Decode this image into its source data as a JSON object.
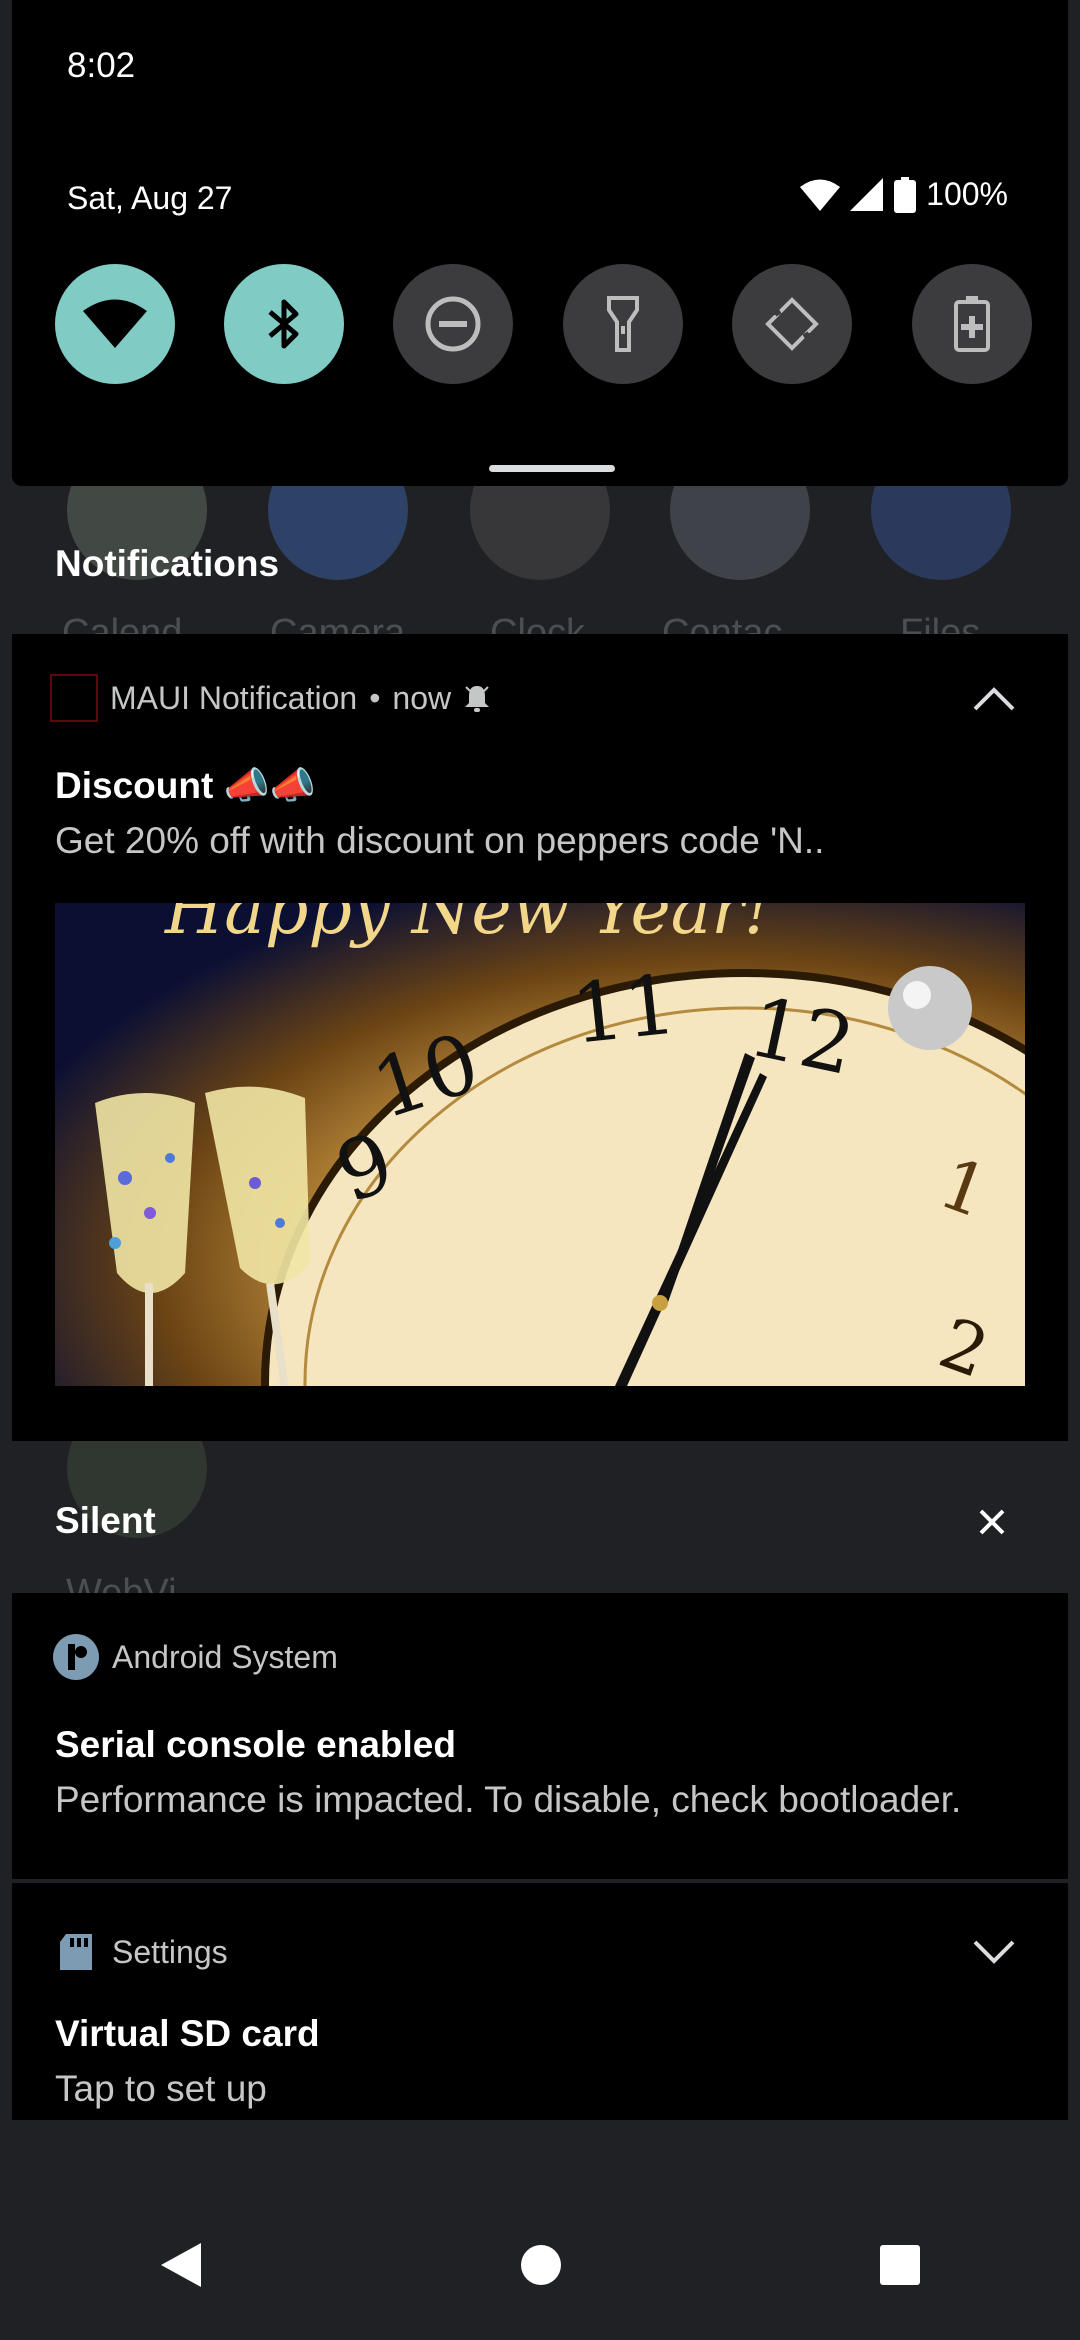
{
  "status_bar": {
    "time": "8:02"
  },
  "quick_settings": {
    "date": "Sat, Aug 27",
    "battery": "100%",
    "tiles": [
      {
        "name": "wifi",
        "state": "on",
        "icon": "wifi-icon"
      },
      {
        "name": "bluetooth",
        "state": "on",
        "icon": "bluetooth-icon"
      },
      {
        "name": "do-not-disturb",
        "state": "off",
        "icon": "minus-circle-icon"
      },
      {
        "name": "flashlight",
        "state": "off",
        "icon": "flashlight-icon"
      },
      {
        "name": "auto-rotate",
        "state": "off",
        "icon": "rotate-icon"
      },
      {
        "name": "battery-saver",
        "state": "off",
        "icon": "battery-saver-icon"
      }
    ]
  },
  "background_apps": [
    "Calend",
    "Camera",
    "Clock",
    "Contac",
    "Files",
    "WebVi"
  ],
  "notifications_section": {
    "title": "Notifications",
    "maui": {
      "app": "MAUI Notification",
      "separator": "•",
      "time": "now",
      "title": "Discount 📣📣",
      "text": "Get 20% off with discount on peppers code 'N..",
      "image_text": "Happy New Year!"
    }
  },
  "silent_section": {
    "title": "Silent",
    "android_system": {
      "app": "Android System",
      "title": "Serial console enabled",
      "text": "Performance is impacted. To disable, check bootloader."
    },
    "settings": {
      "app": "Settings",
      "title": "Virtual SD card",
      "text": "Tap to set up"
    }
  },
  "colors": {
    "tile_on": "#80cbc4",
    "tile_off": "#3c3c3e",
    "shade_bg": "#202124",
    "card_bg": "#000000"
  }
}
